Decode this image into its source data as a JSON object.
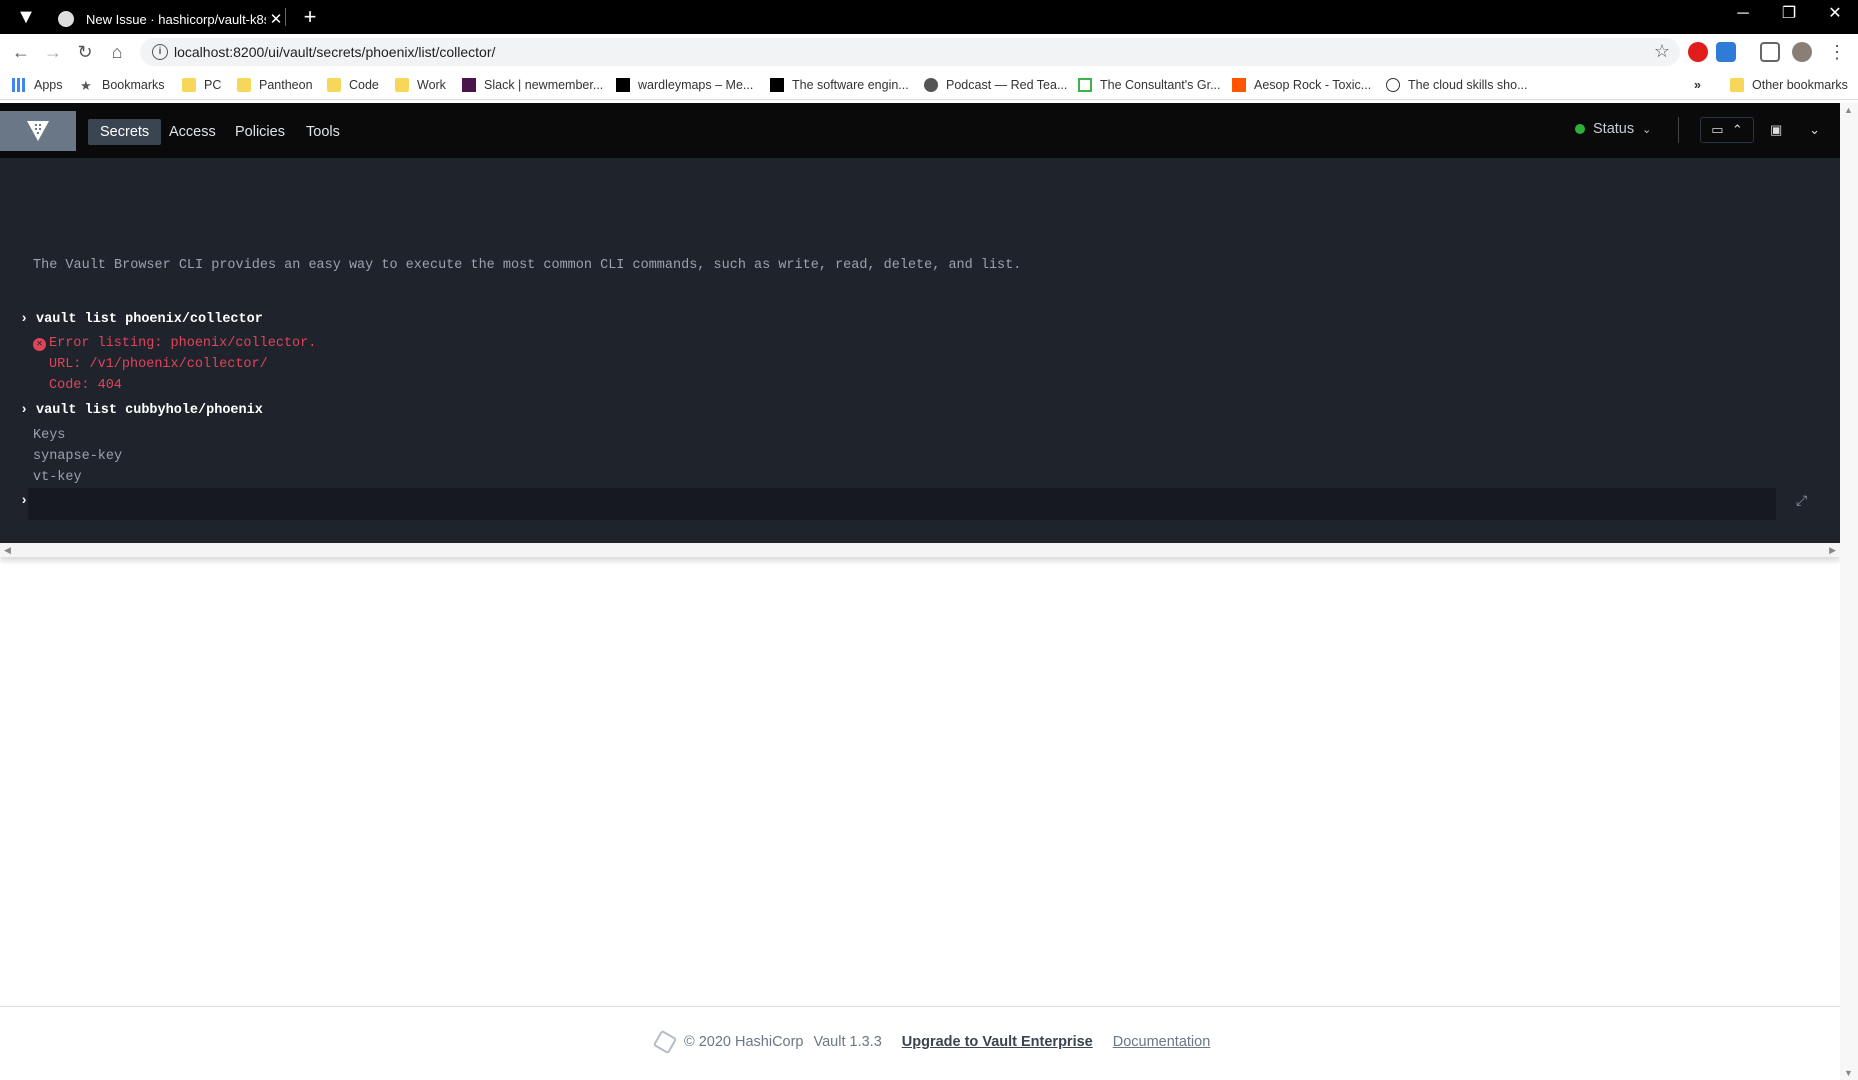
{
  "browser": {
    "tab_title": "New Issue · hashicorp/vault-k8s",
    "url": "localhost:8200/ui/vault/secrets/phoenix/list/collector/",
    "bookmarks": [
      "Apps",
      "Bookmarks",
      "PC",
      "Pantheon",
      "Code",
      "Work",
      "Slack | newmember...",
      "wardleymaps – Me...",
      "The software engin...",
      "Podcast — Red Tea...",
      "The Consultant's Gr...",
      "Aesop Rock - Toxic...",
      "The cloud skills sho..."
    ],
    "overflow": "»",
    "other_bookmarks": "Other bookmarks"
  },
  "vault_nav": {
    "items": [
      "Secrets",
      "Access",
      "Policies",
      "Tools"
    ],
    "status": "Status"
  },
  "console": {
    "intro": "The Vault Browser CLI provides an easy way to execute the most common CLI commands, such as write, read, delete, and list.",
    "cmd1": "vault list phoenix/collector",
    "err_line1": "Error listing: phoenix/collector.",
    "err_line2": "URL: /v1/phoenix/collector/",
    "err_line3": "Code: 404",
    "cmd2": "vault list cubbyhole/phoenix",
    "out_header": "Keys",
    "out_keys": [
      "synapse-key",
      "vt-key"
    ]
  },
  "footer": {
    "copyright": "© 2020 HashiCorp",
    "version": "Vault 1.3.3",
    "upgrade": "Upgrade to Vault Enterprise",
    "docs": "Documentation"
  }
}
